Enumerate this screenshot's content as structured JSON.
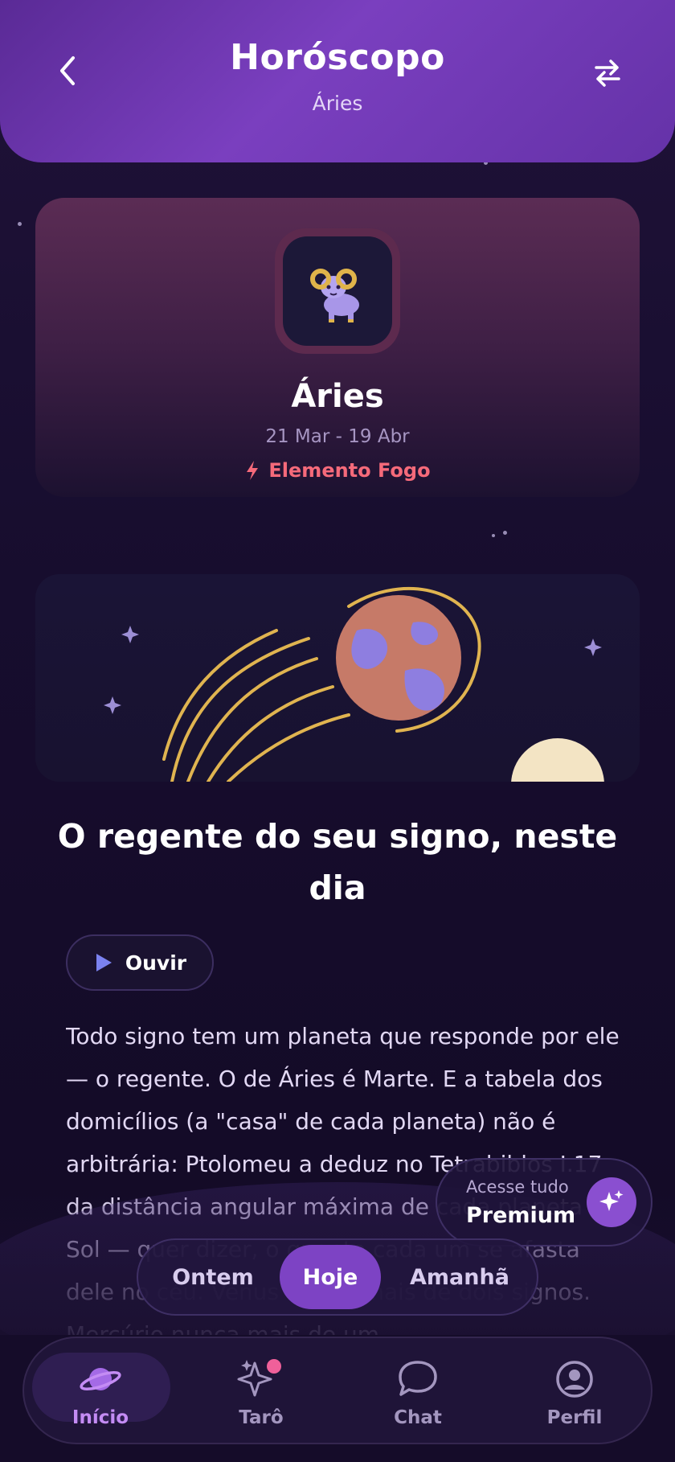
{
  "header": {
    "title": "Horóscopo",
    "subtitle": "Áries"
  },
  "sign": {
    "name": "Áries",
    "dates": "21 Mar - 19 Abr",
    "element": "Elemento Fogo",
    "element_color": "#f56a7a"
  },
  "article": {
    "title": "O regente do seu signo, neste dia",
    "listen_label": "Ouvir",
    "body": "Todo signo tem um planeta que responde por ele — o regente. O de Áries é Marte. E a tabela dos domicílios (a \"casa\" de cada planeta) não é arbitrária: Ptolomeu a deduz no Tetrabiblos I.17 da distância angular máxima de cada planeta ao Sol — quer dizer, o quanto cada um se afasta dele no céu. Vênus nunca mais de dois signos. Mercúrio nunca mais de um."
  },
  "premium": {
    "small": "Acesse tudo",
    "big": "Premium"
  },
  "days": {
    "yesterday": "Ontem",
    "today": "Hoje",
    "tomorrow": "Amanhã",
    "selected": "Hoje"
  },
  "nav": {
    "items": [
      {
        "label": "Início",
        "icon": "planet-icon",
        "active": true
      },
      {
        "label": "Tarô",
        "icon": "sparkles-icon",
        "active": false,
        "badge": true
      },
      {
        "label": "Chat",
        "icon": "chat-bubble-icon",
        "active": false
      },
      {
        "label": "Perfil",
        "icon": "user-icon",
        "active": false
      }
    ]
  },
  "colors": {
    "accent": "#7d43c4",
    "header": "#6a34ad",
    "background": "#140c28"
  }
}
